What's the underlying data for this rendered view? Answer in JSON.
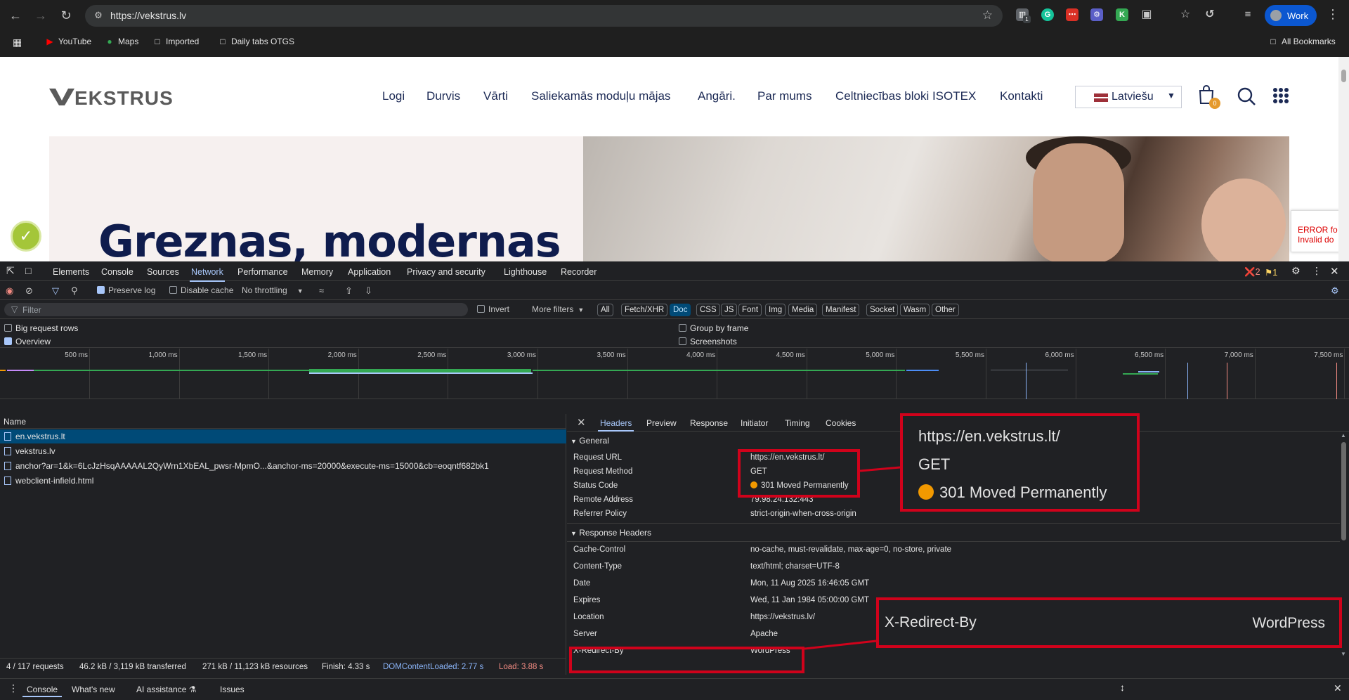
{
  "browser": {
    "url": "https://vekstrus.lv",
    "profile_label": "Work",
    "extension_badge": "1",
    "bookmarks": [
      "YouTube",
      "Maps",
      "Imported",
      "Daily tabs OTGS"
    ],
    "all_bookmarks": "All Bookmarks"
  },
  "site": {
    "nav": [
      "Logi",
      "Durvis",
      "Vārti",
      "Saliekamās moduļu mājas",
      "Angāri.",
      "Par mums",
      "Celtniecības bloki ISOTEX",
      "Kontakti"
    ],
    "language": "Latviešu",
    "cart_count": "0",
    "hero_title": "Greznas, modernas",
    "recaptcha_error": [
      "ERROR fo",
      "Invalid do"
    ]
  },
  "devtools": {
    "tabs": [
      "Elements",
      "Console",
      "Sources",
      "Network",
      "Performance",
      "Memory",
      "Application",
      "Privacy and security",
      "Lighthouse",
      "Recorder"
    ],
    "active_tab": "Network",
    "error_count": "2",
    "warning_count": "1",
    "toolbar": {
      "preserve_log": "Preserve log",
      "disable_cache": "Disable cache",
      "throttling": "No throttling"
    },
    "filter": {
      "placeholder": "Filter",
      "invert": "Invert",
      "more_filters": "More filters",
      "types": [
        "All",
        "Fetch/XHR",
        "Doc",
        "CSS",
        "JS",
        "Font",
        "Img",
        "Media",
        "Manifest",
        "Socket",
        "Wasm",
        "Other"
      ],
      "active_type": "Doc"
    },
    "settings": {
      "big_request_rows": "Big request rows",
      "overview": "Overview",
      "group_by_frame": "Group by frame",
      "screenshots": "Screenshots"
    },
    "timeline_ticks": [
      "500 ms",
      "1,000 ms",
      "1,500 ms",
      "2,000 ms",
      "2,500 ms",
      "3,000 ms",
      "3,500 ms",
      "4,000 ms",
      "4,500 ms",
      "5,000 ms",
      "5,500 ms",
      "6,000 ms",
      "6,500 ms",
      "7,000 ms",
      "7,500 ms"
    ],
    "requests": {
      "column_name": "Name",
      "rows": [
        "en.vekstrus.lt",
        "vekstrus.lv",
        "anchor?ar=1&k=6LcJzHsqAAAAAL2QyWrn1XbEAL_pwsr-MpmO...&anchor-ms=20000&execute-ms=15000&cb=eoqntf682bk1",
        "webclient-infield.html"
      ]
    },
    "detail": {
      "tabs": [
        "Headers",
        "Preview",
        "Response",
        "Initiator",
        "Timing",
        "Cookies"
      ],
      "general_title": "General",
      "general": [
        {
          "key": "Request URL",
          "value": "https://en.vekstrus.lt/"
        },
        {
          "key": "Request Method",
          "value": "GET"
        },
        {
          "key": "Status Code",
          "value": "301 Moved Permanently"
        },
        {
          "key": "Remote Address",
          "value": "79.98.24.132:443"
        },
        {
          "key": "Referrer Policy",
          "value": "strict-origin-when-cross-origin"
        }
      ],
      "response_title": "Response Headers",
      "response": [
        {
          "key": "Cache-Control",
          "value": "no-cache, must-revalidate, max-age=0, no-store, private"
        },
        {
          "key": "Content-Type",
          "value": "text/html; charset=UTF-8"
        },
        {
          "key": "Date",
          "value": "Mon, 11 Aug 2025 16:46:05 GMT"
        },
        {
          "key": "Expires",
          "value": "Wed, 11 Jan 1984 05:00:00 GMT"
        },
        {
          "key": "Location",
          "value": "https://vekstrus.lv/"
        },
        {
          "key": "Server",
          "value": "Apache"
        },
        {
          "key": "X-Redirect-By",
          "value": "WordPress"
        }
      ]
    },
    "callouts": {
      "url": "https://en.vekstrus.lt/",
      "method": "GET",
      "status": "301 Moved Permanently",
      "redirect_key": "X-Redirect-By",
      "redirect_value": "WordPress"
    },
    "status_bar": {
      "requests": "4 / 117 requests",
      "transferred": "46.2 kB / 3,119 kB transferred",
      "resources": "271 kB / 11,123 kB resources",
      "finish": "Finish: 4.33 s",
      "dom_content_loaded": "DOMContentLoaded: 2.77 s",
      "load": "Load: 3.88 s"
    },
    "drawer_tabs": [
      "Console",
      "What's new",
      "AI assistance",
      "Issues"
    ]
  },
  "colors": {
    "chrome_bg": "#1f1f1f",
    "devtools_bg": "#202124",
    "accent_blue": "#a8c7fa",
    "selected_row": "#004a77",
    "highlight_red": "#d0021b",
    "status_orange": "#f29900",
    "site_navy": "#1c2a55",
    "dcl_blue": "#8ab4f8",
    "load_red": "#f28b82"
  }
}
